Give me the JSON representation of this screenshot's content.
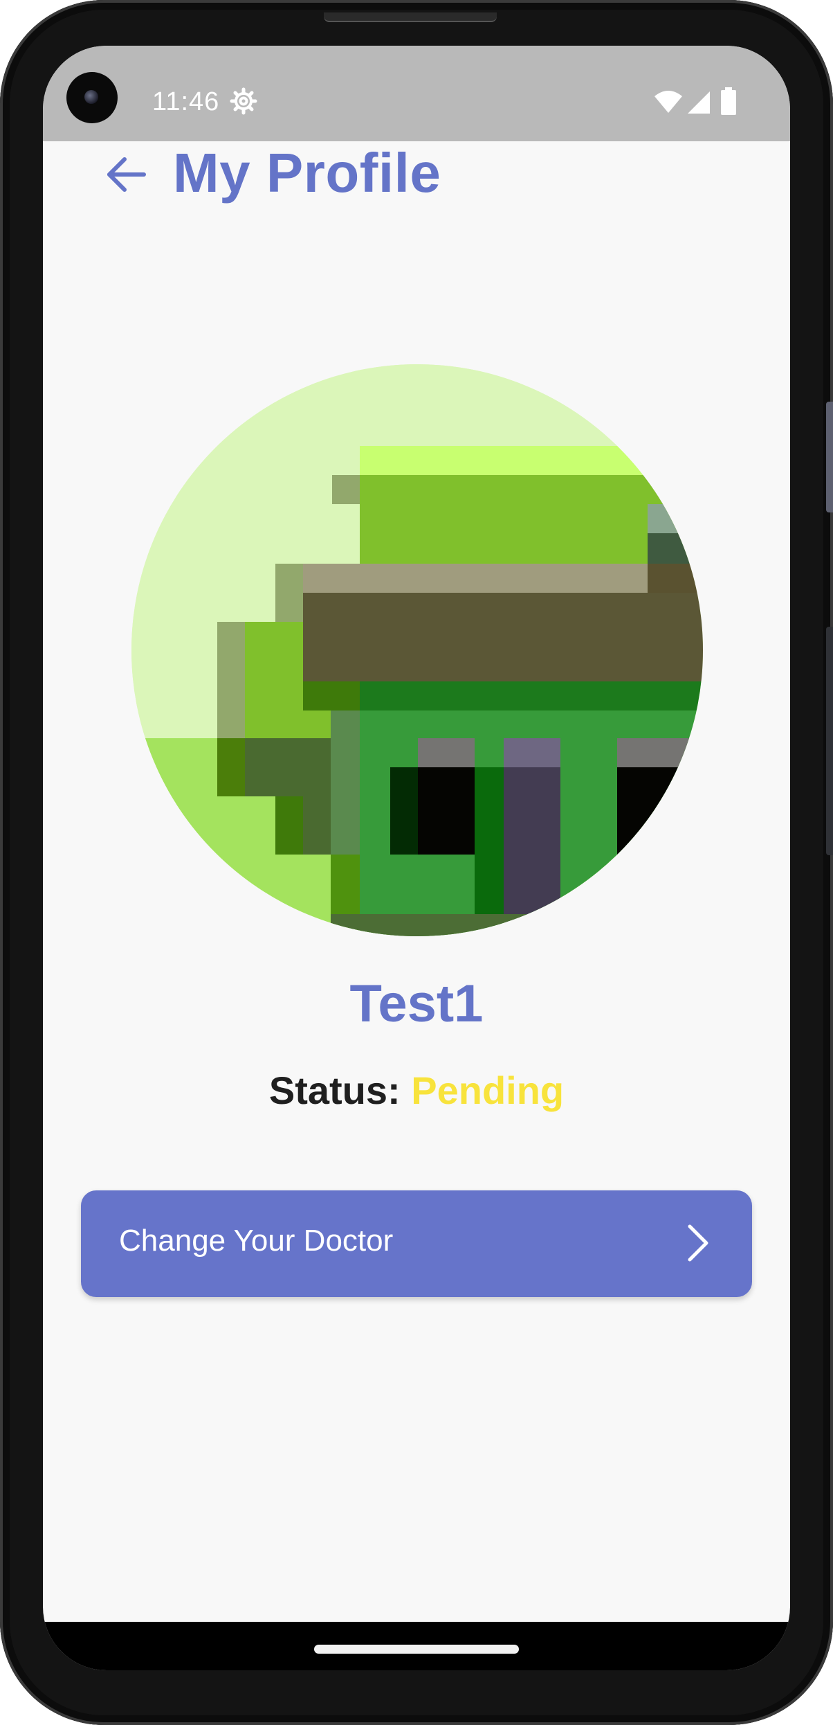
{
  "status_bar": {
    "time": "11:46",
    "icons": [
      "gear-icon",
      "wifi-icon",
      "signal-icon",
      "battery-icon"
    ]
  },
  "header": {
    "back_icon": "arrow-left-icon",
    "title": "My Profile"
  },
  "profile": {
    "avatar": "pixelated-green-avatar",
    "username": "Test1",
    "status_label": "Status:",
    "status_value": "Pending"
  },
  "actions": {
    "change_doctor_label": "Change Your Doctor",
    "change_doctor_icon": "chevron-right-icon"
  },
  "colors": {
    "accent": "#6474c8",
    "button_bg": "#6674ca",
    "status_pending": "#f8e33c",
    "status_bar_bg": "#b9b9b9",
    "screen_bg": "#f8f8f8"
  }
}
